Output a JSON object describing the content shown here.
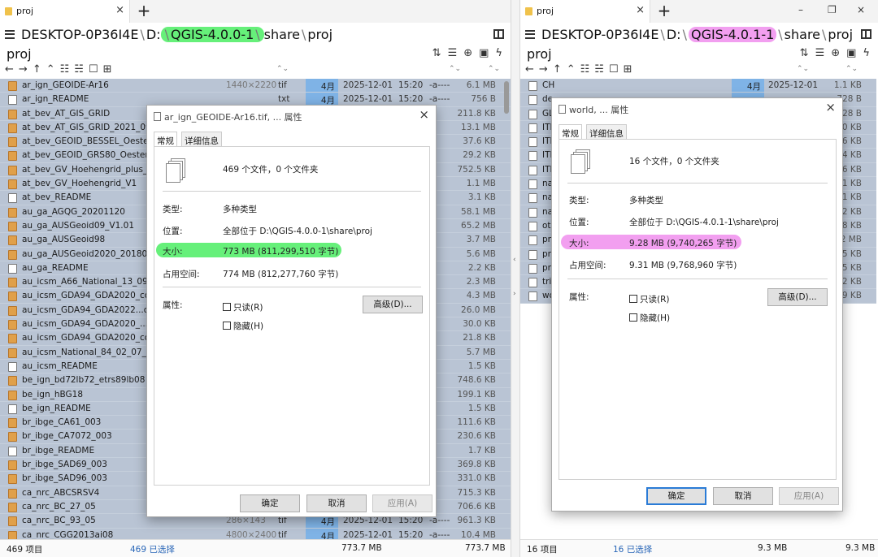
{
  "left": {
    "tab_label": "proj",
    "path": {
      "host": "DESKTOP-0P36I4E",
      "drive": "D:",
      "highlight": "QGIS-4.0.0-1",
      "p1": "share",
      "p2": "proj"
    },
    "folder_name": "proj",
    "rows": [
      {
        "name": "ar_ign_GEOIDE-Ar16",
        "dims": "1440×2220",
        "ext": "tif",
        "month": "4月",
        "date": "2025-12-01",
        "time": "15:20",
        "attr": "-a----",
        "size": "6.1 MB",
        "icon": "tif"
      },
      {
        "name": "ar_ign_README",
        "dims": "",
        "ext": "txt",
        "month": "4月",
        "date": "2025-12-01",
        "time": "15:20",
        "attr": "-a----",
        "size": "756 B",
        "icon": "txt"
      },
      {
        "name": "at_bev_AT_GIS_GRID",
        "dims": "",
        "ext": "",
        "month": "",
        "date": "",
        "time": "",
        "attr": "",
        "size": "211.8 KB",
        "icon": "tif"
      },
      {
        "name": "at_bev_AT_GIS_GRID_2021_09_2",
        "dims": "",
        "ext": "",
        "month": "",
        "date": "",
        "time": "",
        "attr": "",
        "size": "13.1 MB",
        "icon": "tif"
      },
      {
        "name": "at_bev_GEOID_BESSEL_Oesterre",
        "dims": "",
        "ext": "",
        "month": "",
        "date": "",
        "time": "",
        "attr": "",
        "size": "37.6 KB",
        "icon": "tif"
      },
      {
        "name": "at_bev_GEOID_GRS80_Oesterre",
        "dims": "",
        "ext": "",
        "month": "",
        "date": "",
        "time": "",
        "attr": "",
        "size": "29.2 KB",
        "icon": "tif"
      },
      {
        "name": "at_bev_GV_Hoehengrid_plus_G",
        "dims": "",
        "ext": "",
        "month": "",
        "date": "",
        "time": "",
        "attr": "",
        "size": "752.5 KB",
        "icon": "tif"
      },
      {
        "name": "at_bev_GV_Hoehengrid_V1",
        "dims": "",
        "ext": "",
        "month": "",
        "date": "",
        "time": "",
        "attr": "",
        "size": "1.1 MB",
        "icon": "tif"
      },
      {
        "name": "at_bev_README",
        "dims": "",
        "ext": "",
        "month": "",
        "date": "",
        "time": "",
        "attr": "",
        "size": "3.1 KB",
        "icon": "txt"
      },
      {
        "name": "au_ga_AGQG_20201120",
        "dims": "",
        "ext": "",
        "month": "",
        "date": "",
        "time": "",
        "attr": "",
        "size": "58.1 MB",
        "icon": "tif"
      },
      {
        "name": "au_ga_AUSGeoid09_V1.01",
        "dims": "",
        "ext": "",
        "month": "",
        "date": "",
        "time": "",
        "attr": "",
        "size": "65.2 MB",
        "icon": "tif"
      },
      {
        "name": "au_ga_AUSGeoid98",
        "dims": "",
        "ext": "",
        "month": "",
        "date": "",
        "time": "",
        "attr": "",
        "size": "3.7 MB",
        "icon": "tif"
      },
      {
        "name": "au_ga_AUSGeoid2020_2018020",
        "dims": "",
        "ext": "",
        "month": "",
        "date": "",
        "time": "",
        "attr": "",
        "size": "5.6 MB",
        "icon": "tif"
      },
      {
        "name": "au_ga_README",
        "dims": "",
        "ext": "",
        "month": "",
        "date": "",
        "time": "",
        "attr": "",
        "size": "2.2 KB",
        "icon": "txt"
      },
      {
        "name": "au_icsm_A66_National_13_09_0",
        "dims": "",
        "ext": "",
        "month": "",
        "date": "",
        "time": "",
        "attr": "",
        "size": "2.3 MB",
        "icon": "tif"
      },
      {
        "name": "au_icsm_GDA94_GDA2020_conf",
        "dims": "",
        "ext": "",
        "month": "",
        "date": "",
        "time": "",
        "attr": "",
        "size": "4.3 MB",
        "icon": "tif"
      },
      {
        "name": "au_icsm_GDA94_GDA2022...orma",
        "dims": "",
        "ext": "",
        "month": "",
        "date": "",
        "time": "",
        "attr": "",
        "size": "26.0 MB",
        "icon": "tif"
      },
      {
        "name": "au_icsm_GDA94_GDA2020_...rm",
        "dims": "",
        "ext": "",
        "month": "",
        "date": "",
        "time": "",
        "attr": "",
        "size": "30.0 KB",
        "icon": "tif"
      },
      {
        "name": "au_icsm_GDA94_GDA2020_conf",
        "dims": "",
        "ext": "",
        "month": "",
        "date": "",
        "time": "",
        "attr": "",
        "size": "21.8 KB",
        "icon": "tif"
      },
      {
        "name": "au_icsm_National_84_02_07_01",
        "dims": "",
        "ext": "",
        "month": "",
        "date": "",
        "time": "",
        "attr": "",
        "size": "5.7 MB",
        "icon": "tif"
      },
      {
        "name": "au_icsm_README",
        "dims": "",
        "ext": "",
        "month": "",
        "date": "",
        "time": "",
        "attr": "",
        "size": "1.5 KB",
        "icon": "txt"
      },
      {
        "name": "be_ign_bd72lb72_etrs89lb08",
        "dims": "",
        "ext": "",
        "month": "",
        "date": "",
        "time": "",
        "attr": "",
        "size": "748.6 KB",
        "icon": "tif"
      },
      {
        "name": "be_ign_hBG18",
        "dims": "",
        "ext": "",
        "month": "",
        "date": "",
        "time": "",
        "attr": "",
        "size": "199.1 KB",
        "icon": "tif"
      },
      {
        "name": "be_ign_README",
        "dims": "",
        "ext": "",
        "month": "",
        "date": "",
        "time": "",
        "attr": "",
        "size": "1.5 KB",
        "icon": "txt"
      },
      {
        "name": "br_ibge_CA61_003",
        "dims": "",
        "ext": "",
        "month": "",
        "date": "",
        "time": "",
        "attr": "",
        "size": "111.6 KB",
        "icon": "tif"
      },
      {
        "name": "br_ibge_CA7072_003",
        "dims": "",
        "ext": "",
        "month": "",
        "date": "",
        "time": "",
        "attr": "",
        "size": "230.6 KB",
        "icon": "tif"
      },
      {
        "name": "br_ibge_README",
        "dims": "",
        "ext": "",
        "month": "",
        "date": "",
        "time": "",
        "attr": "",
        "size": "1.7 KB",
        "icon": "txt"
      },
      {
        "name": "br_ibge_SAD69_003",
        "dims": "",
        "ext": "",
        "month": "",
        "date": "",
        "time": "",
        "attr": "",
        "size": "369.8 KB",
        "icon": "tif"
      },
      {
        "name": "br_ibge_SAD96_003",
        "dims": "",
        "ext": "",
        "month": "",
        "date": "",
        "time": "",
        "attr": "",
        "size": "331.0 KB",
        "icon": "tif"
      },
      {
        "name": "ca_nrc_ABCSRSV4",
        "dims": "",
        "ext": "",
        "month": "",
        "date": "",
        "time": "",
        "attr": "",
        "size": "715.3 KB",
        "icon": "tif"
      },
      {
        "name": "ca_nrc_BC_27_05",
        "dims": "",
        "ext": "",
        "month": "",
        "date": "",
        "time": "",
        "attr": "",
        "size": "706.6 KB",
        "icon": "tif"
      },
      {
        "name": "ca_nrc_BC_93_05",
        "dims": "286×143",
        "ext": "tif",
        "month": "4月",
        "date": "2025-12-01",
        "time": "15:20",
        "attr": "-a----",
        "size": "961.3 KB",
        "icon": "tif"
      },
      {
        "name": "ca_nrc_CGG2013ai08",
        "dims": "4800×2400",
        "ext": "tif",
        "month": "4月",
        "date": "2025-12-01",
        "time": "15:20",
        "attr": "-a----",
        "size": "10.4 MB",
        "icon": "tif"
      }
    ],
    "status": {
      "count": "469 项目",
      "selected": "469 已选择",
      "size1": "773.7 MB",
      "size2": "773.7 MB"
    }
  },
  "left_dialog": {
    "title": "ar_ign_GEOIDE-Ar16.tif, ... 属性",
    "tab_general": "常规",
    "tab_details": "详细信息",
    "summary": "469 个文件，0 个文件夹",
    "type_label": "类型:",
    "type_value": "多种类型",
    "location_label": "位置:",
    "location_value": "全部位于 D:\\QGIS-4.0.0-1\\share\\proj",
    "size_label": "大小:",
    "size_value": "773 MB (811,299,510 字节)",
    "disk_label": "占用空间:",
    "disk_value": "774 MB (812,277,760 字节)",
    "attr_label": "属性:",
    "readonly": "只读(R)",
    "hidden": "隐藏(H)",
    "advanced": "高级(D)...",
    "ok": "确定",
    "cancel": "取消",
    "apply": "应用(A)",
    "highlight_color": "#66f07a"
  },
  "right": {
    "tab_label": "proj",
    "path": {
      "host": "DESKTOP-0P36I4E",
      "drive": "D:",
      "highlight": "QGIS-4.0.1-1",
      "p1": "share",
      "p2": "proj"
    },
    "folder_name": "proj",
    "rows": [
      {
        "name": "CH",
        "month": "4月",
        "date": "2025-12-01",
        "size": "1.1 KB",
        "icon": "txt"
      },
      {
        "name": "de",
        "month": "",
        "date": "",
        "size": "728 B",
        "icon": "txt"
      },
      {
        "name": "GL",
        "month": "",
        "date": "",
        "size": "728 B",
        "icon": "txt"
      },
      {
        "name": "ITF",
        "month": "",
        "date": "",
        "size": "2.0 KB",
        "icon": "txt"
      },
      {
        "name": "ITF",
        "month": "",
        "date": "",
        "size": "2.6 KB",
        "icon": "txt"
      },
      {
        "name": "ITF",
        "month": "",
        "date": "",
        "size": "2.4 KB",
        "icon": "txt"
      },
      {
        "name": "ITF",
        "month": "",
        "date": "",
        "size": "5.6 KB",
        "icon": "txt"
      },
      {
        "name": "na",
        "month": "",
        "date": "",
        "size": "2.1 KB",
        "icon": "txt"
      },
      {
        "name": "na",
        "month": "",
        "date": "",
        "size": "1.1 KB",
        "icon": "txt"
      },
      {
        "name": "na",
        "month": "",
        "date": "",
        "size": "5.2 KB",
        "icon": "txt"
      },
      {
        "name": "oth",
        "month": "",
        "date": "",
        "size": "6.8 KB",
        "icon": "txt"
      },
      {
        "name": "pro",
        "month": "",
        "date": "",
        "size": "9.2 MB",
        "icon": "txt"
      },
      {
        "name": "pro",
        "month": "",
        "date": "",
        "size": "1.5 KB",
        "icon": "txt"
      },
      {
        "name": "pro",
        "month": "",
        "date": "",
        "size": "7.5 KB",
        "icon": "txt"
      },
      {
        "name": "tria",
        "month": "",
        "date": "",
        "size": "4.2 KB",
        "icon": "txt"
      },
      {
        "name": "wo",
        "month": "",
        "date": "",
        "size": "9.9 KB",
        "icon": "txt"
      }
    ],
    "status": {
      "count": "16 项目",
      "selected": "16 已选择",
      "size1": "9.3 MB",
      "size2": "9.3 MB"
    }
  },
  "right_dialog": {
    "title": "world, ... 属性",
    "tab_general": "常规",
    "tab_details": "详细信息",
    "summary": "16 个文件，0 个文件夹",
    "type_label": "类型:",
    "type_value": "多种类型",
    "location_label": "位置:",
    "location_value": "全部位于 D:\\QGIS-4.0.1-1\\share\\proj",
    "size_label": "大小:",
    "size_value": "9.28 MB (9,740,265 字节)",
    "disk_label": "占用空间:",
    "disk_value": "9.31 MB (9,768,960 字节)",
    "attr_label": "属性:",
    "readonly": "只读(R)",
    "hidden": "隐藏(H)",
    "advanced": "高级(D)...",
    "ok": "确定",
    "cancel": "取消",
    "apply": "应用(A)",
    "highlight_color": "#f29ff0"
  }
}
